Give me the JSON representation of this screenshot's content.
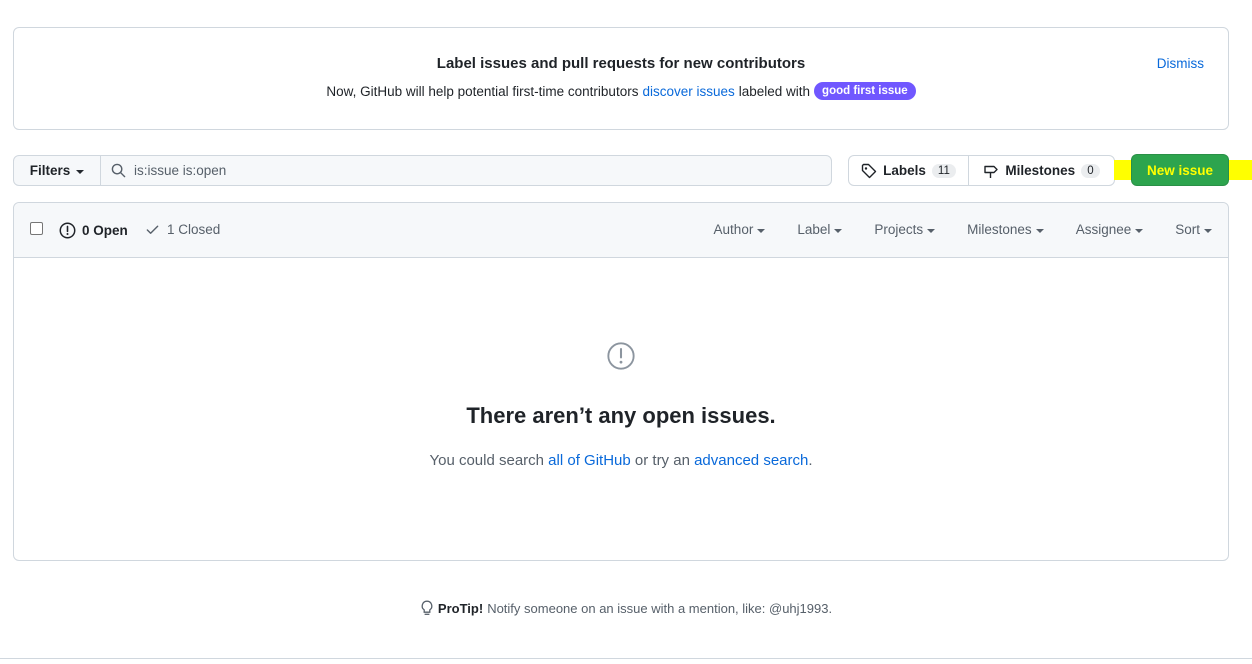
{
  "banner": {
    "title": "Label issues and pull requests for new contributors",
    "text_before": "Now, GitHub will help potential first-time contributors",
    "link": "discover issues",
    "text_after": "labeled with",
    "label": "good first issue",
    "label_color": "#7057ff",
    "dismiss": "Dismiss"
  },
  "toolbar": {
    "filters_label": "Filters",
    "search_value": "is:issue is:open",
    "labels_label": "Labels",
    "labels_count": "11",
    "milestones_label": "Milestones",
    "milestones_count": "0",
    "new_issue_label": "New issue"
  },
  "issues": {
    "open_label": "0 Open",
    "closed_label": "1 Closed",
    "filters": [
      "Author",
      "Label",
      "Projects",
      "Milestones",
      "Assignee",
      "Sort"
    ],
    "blank_title": "There aren’t any open issues.",
    "blank_text_before": "You could search",
    "blank_link1": "all of GitHub",
    "blank_text_mid": "or try an",
    "blank_link2": "advanced search",
    "blank_text_end": "."
  },
  "protip": {
    "strong": "ProTip!",
    "text": "Notify someone on an issue with a mention, like: @uhj1993."
  },
  "colors": {
    "accent": "#0969da",
    "success": "#2da44e",
    "highlight": "#ffff00"
  }
}
